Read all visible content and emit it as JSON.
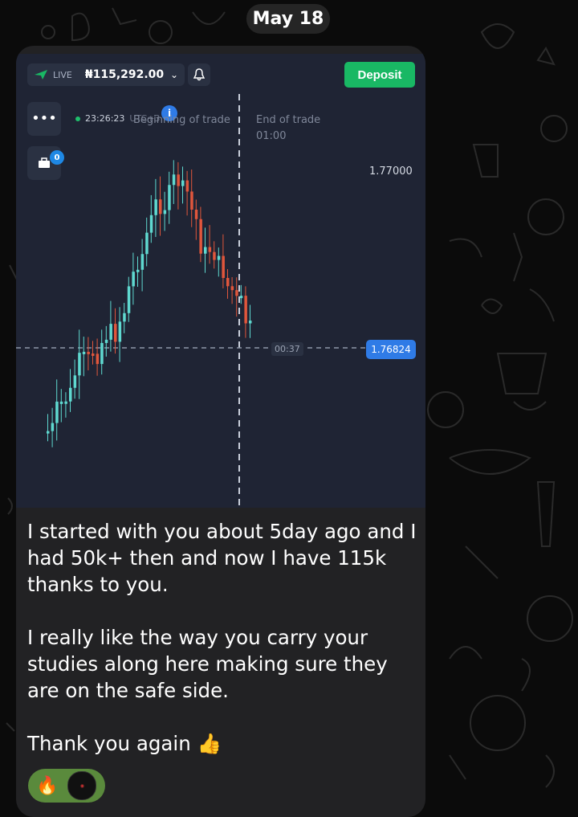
{
  "date_label": "May 18",
  "app": {
    "mode_label": "LIVE",
    "balance": "₦115,292.00",
    "deposit_label": "Deposit",
    "clock": "23:26:23",
    "clock_suffix": "UTC+3",
    "trade_begin_label": "Beginning of trade",
    "trade_end_label": "End of trade",
    "trade_end_time": "01:00",
    "portfolio_badge": "0",
    "price_upper": "1.77000",
    "price_current": "1.76824",
    "countdown": "00:37"
  },
  "message": {
    "paragraphs": [
      "I started with you about 5day ago and I had 50k+ then and now I have 115k thanks to you.",
      "I really like the way you carry your studies along here making sure they are on the safe side.",
      "Thank you again 👍"
    ]
  },
  "reaction": {
    "emoji": "🔥"
  },
  "colors": {
    "up": "#5fd9d0",
    "down": "#e0563c",
    "deposit": "#19b864",
    "accent": "#2f7be6"
  }
}
